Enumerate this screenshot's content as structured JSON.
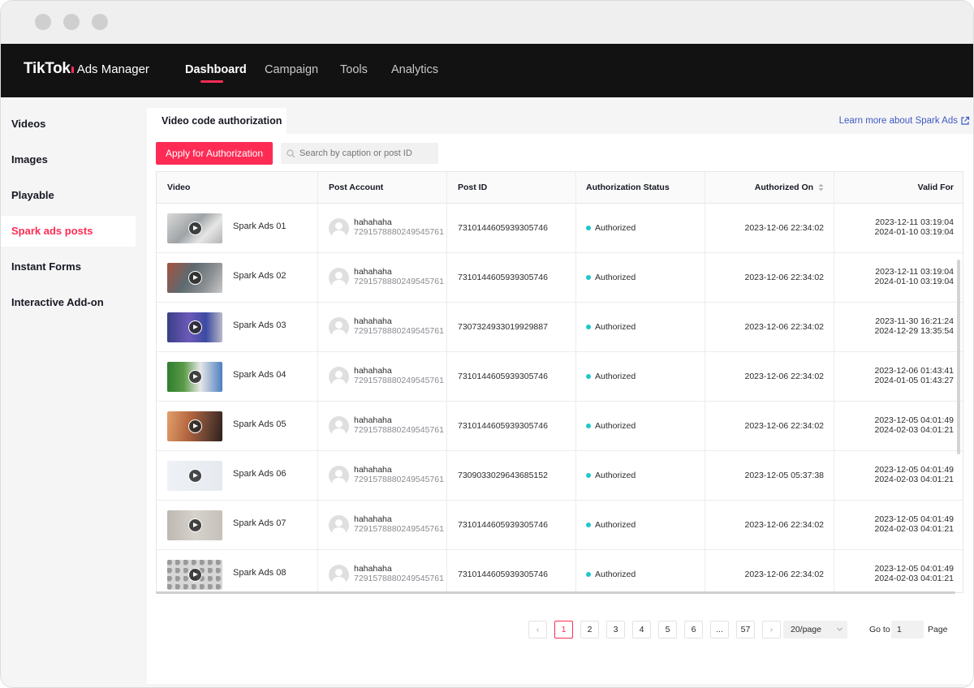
{
  "brand": {
    "name": "TikTok",
    "sub": "Ads Manager",
    "accent": "#fe2c55"
  },
  "nav": [
    {
      "label": "Dashboard",
      "active": true
    },
    {
      "label": "Campaign"
    },
    {
      "label": "Tools"
    },
    {
      "label": "Analytics"
    }
  ],
  "sidebar": [
    {
      "label": "Videos"
    },
    {
      "label": "Images"
    },
    {
      "label": "Playable"
    },
    {
      "label": "Spark ads posts",
      "active": true
    },
    {
      "label": "Instant Forms"
    },
    {
      "label": "Interactive Add-on"
    }
  ],
  "tab": {
    "label": "Video code authorization"
  },
  "learn_more": {
    "label": "Learn more about Spark Ads",
    "icon": "external-link-icon"
  },
  "toolbar": {
    "apply_label": "Apply for Authorization",
    "search_placeholder": "Search by caption or post ID"
  },
  "table": {
    "headers": {
      "video": "Video",
      "account": "Post Account",
      "post_id": "Post ID",
      "status": "Authorization Status",
      "authorized_on": "Authorized On",
      "valid_for": "Valid For"
    },
    "rows": [
      {
        "video": "Spark Ads 01",
        "account_name": "hahahaha",
        "account_id": "7291578880249545761",
        "post_id": "7310144605939305746",
        "status": "Authorized",
        "authorized_on": "2023-12-06 22:34:02",
        "valid_from": "2023-12-11 03:19:04",
        "valid_to": "2024-01-10 03:19:04"
      },
      {
        "video": "Spark Ads 02",
        "account_name": "hahahaha",
        "account_id": "7291578880249545761",
        "post_id": "7310144605939305746",
        "status": "Authorized",
        "authorized_on": "2023-12-06 22:34:02",
        "valid_from": "2023-12-11 03:19:04",
        "valid_to": "2024-01-10 03:19:04"
      },
      {
        "video": "Spark Ads 03",
        "account_name": "hahahaha",
        "account_id": "7291578880249545761",
        "post_id": "7307324933019929887",
        "status": "Authorized",
        "authorized_on": "2023-12-06 22:34:02",
        "valid_from": "2023-11-30 16:21:24",
        "valid_to": "2024-12-29 13:35:54"
      },
      {
        "video": "Spark Ads 04",
        "account_name": "hahahaha",
        "account_id": "7291578880249545761",
        "post_id": "7310144605939305746",
        "status": "Authorized",
        "authorized_on": "2023-12-06 22:34:02",
        "valid_from": "2023-12-06 01:43:41",
        "valid_to": "2024-01-05 01:43:27"
      },
      {
        "video": "Spark Ads 05",
        "account_name": "hahahaha",
        "account_id": "7291578880249545761",
        "post_id": "7310144605939305746",
        "status": "Authorized",
        "authorized_on": "2023-12-06 22:34:02",
        "valid_from": "2023-12-05 04:01:49",
        "valid_to": "2024-02-03 04:01:21"
      },
      {
        "video": "Spark Ads 06",
        "account_name": "hahahaha",
        "account_id": "7291578880249545761",
        "post_id": "7309033029643685152",
        "status": "Authorized",
        "authorized_on": "2023-12-05 05:37:38",
        "valid_from": "2023-12-05 04:01:49",
        "valid_to": "2024-02-03 04:01:21"
      },
      {
        "video": "Spark Ads 07",
        "account_name": "hahahaha",
        "account_id": "7291578880249545761",
        "post_id": "7310144605939305746",
        "status": "Authorized",
        "authorized_on": "2023-12-06 22:34:02",
        "valid_from": "2023-12-05 04:01:49",
        "valid_to": "2024-02-03 04:01:21"
      },
      {
        "video": "Spark Ads 08",
        "account_name": "hahahaha",
        "account_id": "7291578880249545761",
        "post_id": "7310144605939305746",
        "status": "Authorized",
        "authorized_on": "2023-12-06 22:34:02",
        "valid_from": "2023-12-05 04:01:49",
        "valid_to": "2024-02-03 04:01:21"
      }
    ]
  },
  "pagination": {
    "prev": "‹",
    "pages": [
      "1",
      "2",
      "3",
      "4",
      "5",
      "6",
      "...",
      "57"
    ],
    "current": "1",
    "next": "›",
    "per_page": "20/page",
    "goto_label": "Go to",
    "goto_value": "1",
    "page_label": "Page"
  }
}
